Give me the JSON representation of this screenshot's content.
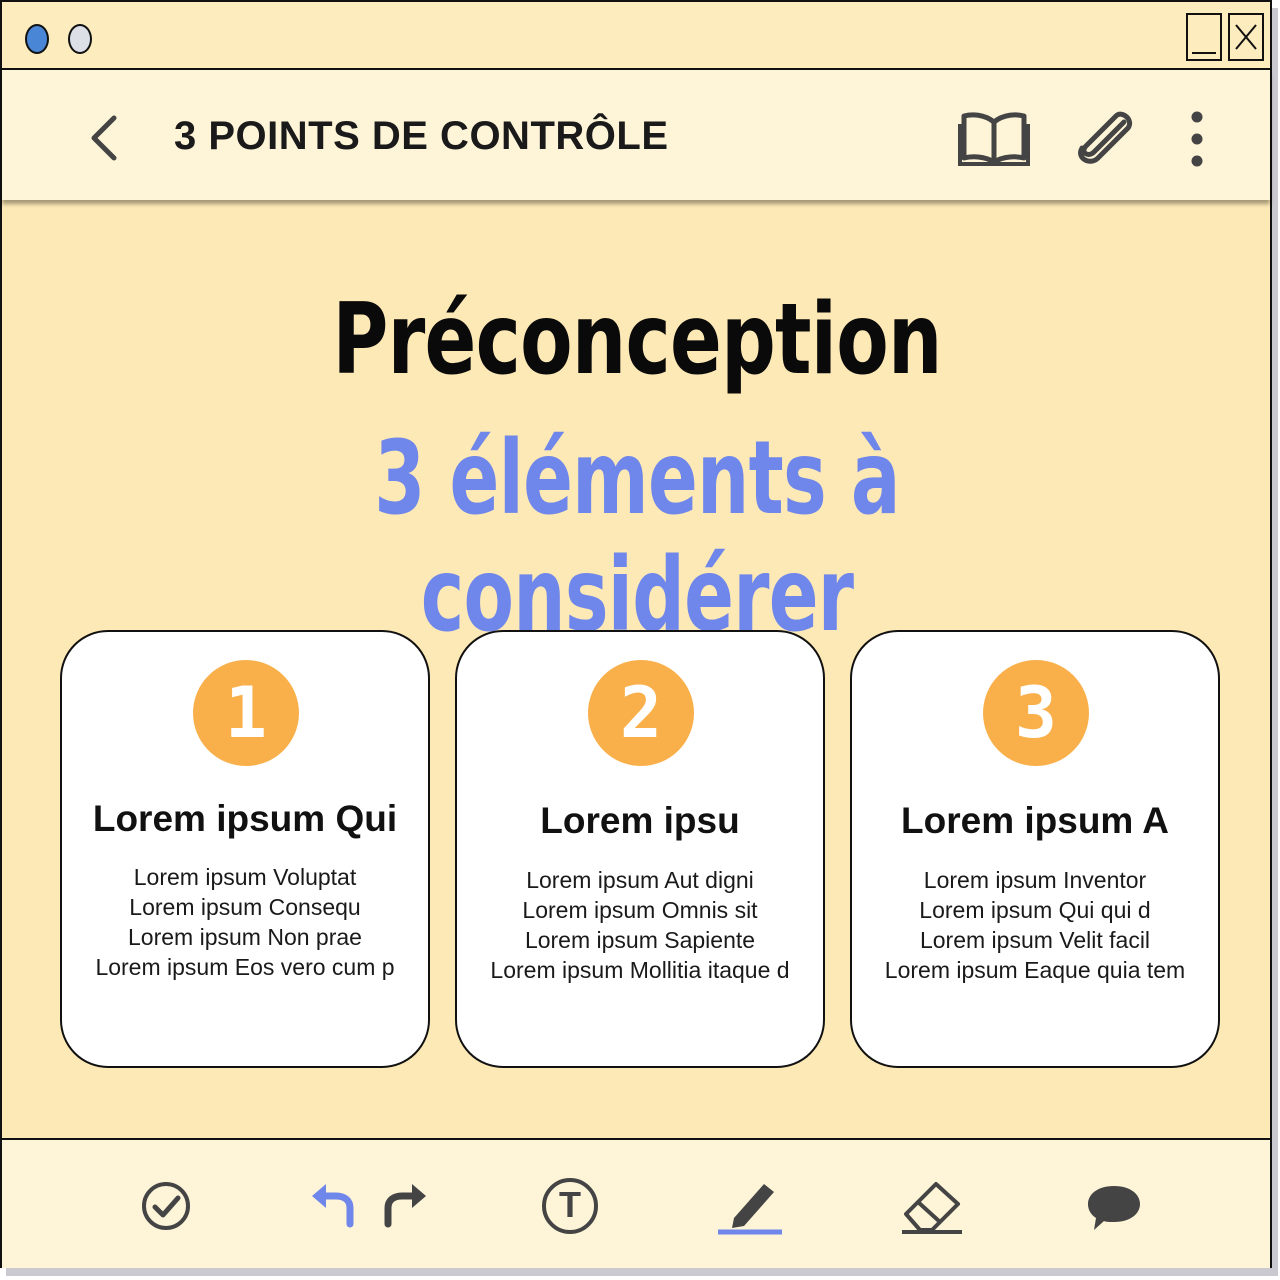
{
  "window": {
    "close_label": "X"
  },
  "appbar": {
    "title": "3 POINTS DE CONTRÔLE"
  },
  "main": {
    "heading": "Préconception",
    "subheading": "3 éléments à considérer",
    "cards": [
      {
        "number": "1",
        "title": "Lorem ipsum Qui",
        "lines": [
          "Lorem ipsum Voluptat",
          "Lorem ipsum Consequ",
          "Lorem ipsum Non prae",
          "Lorem ipsum Eos vero cum p"
        ]
      },
      {
        "number": "2",
        "title": "Lorem ipsu",
        "lines": [
          "Lorem ipsum Aut digni",
          "Lorem ipsum Omnis sit",
          "Lorem ipsum Sapiente",
          "Lorem ipsum Mollitia itaque d"
        ]
      },
      {
        "number": "3",
        "title": "Lorem ipsum A",
        "lines": [
          "Lorem ipsum Inventor",
          "Lorem ipsum Qui qui d",
          "Lorem ipsum Velit facil",
          "Lorem ipsum Eaque quia tem"
        ]
      }
    ]
  },
  "toolbar": {
    "text_tool_glyph": "T"
  },
  "colors": {
    "accent": "#6f86ea",
    "badge": "#f9b04a",
    "background": "#fde9b6"
  },
  "icons": [
    "chevron-left-icon",
    "book-icon",
    "paperclip-icon",
    "more-vertical-icon",
    "check-circle-icon",
    "undo-icon",
    "redo-icon",
    "text-icon",
    "pen-icon",
    "eraser-icon",
    "comment-icon"
  ]
}
